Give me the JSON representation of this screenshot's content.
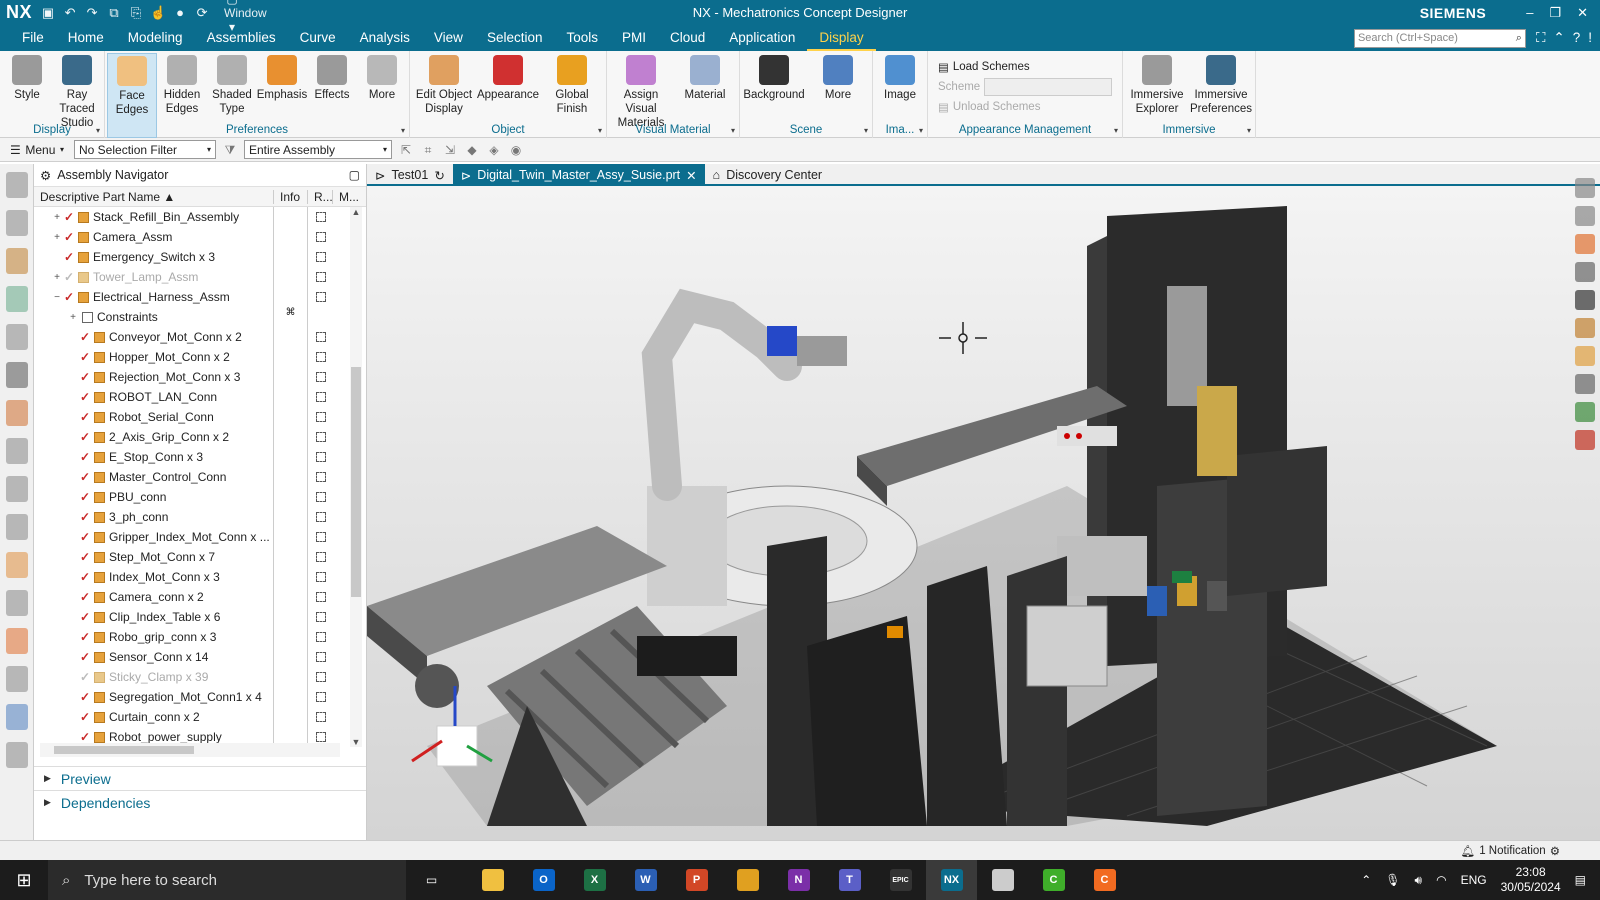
{
  "window": {
    "logo": "NX",
    "title": "NX - Mechatronics Concept Designer",
    "brand": "SIEMENS",
    "window_menu": "Window"
  },
  "menu": {
    "items": [
      "File",
      "Home",
      "Modeling",
      "Assemblies",
      "Curve",
      "Analysis",
      "View",
      "Selection",
      "Tools",
      "PMI",
      "Cloud",
      "Application",
      "Display"
    ],
    "active": "Display",
    "search_placeholder": "Search (Ctrl+Space)"
  },
  "ribbon": {
    "display_group": {
      "label": "Display",
      "buttons": [
        "Style",
        "Ray Traced Studio"
      ]
    },
    "preferences_group": {
      "label": "Preferences",
      "buttons": [
        "Face Edges",
        "Hidden Edges",
        "Shaded Type",
        "Emphasis",
        "Effects",
        "More"
      ]
    },
    "object_group": {
      "label": "Object",
      "buttons": [
        "Edit Object Display",
        "Appearance",
        "Global Finish"
      ]
    },
    "visual_material_group": {
      "label": "Visual Material",
      "buttons": [
        "Assign Visual Materials",
        "Material"
      ]
    },
    "scene_group": {
      "label": "Scene",
      "buttons": [
        "Background",
        "More"
      ]
    },
    "image_group": {
      "label": "Ima...",
      "buttons": [
        "Image"
      ]
    },
    "appearance_mgmt": {
      "label": "Appearance Management",
      "load": "Load Schemes",
      "scheme_label": "Scheme",
      "unload": "Unload Schemes"
    },
    "immersive_group": {
      "label": "Immersive",
      "buttons": [
        "Immersive Explorer",
        "Immersive Preferences"
      ]
    }
  },
  "toolbar2": {
    "menu": "Menu",
    "selection_filter": "No Selection Filter",
    "scope": "Entire Assembly"
  },
  "navigator": {
    "title": "Assembly Navigator",
    "columns": [
      "Descriptive Part Name",
      "Info",
      "R...",
      "M..."
    ],
    "rows": [
      {
        "label": "Stack_Refill_Bin_Assembly",
        "level": 1,
        "exp": "+",
        "dim": false
      },
      {
        "label": "Camera_Assm",
        "level": 1,
        "exp": "+",
        "dim": false
      },
      {
        "label": "Emergency_Switch x 3",
        "level": 1,
        "exp": "",
        "dim": false
      },
      {
        "label": "Tower_Lamp_Assm",
        "level": 1,
        "exp": "+",
        "dim": true
      },
      {
        "label": "Electrical_Harness_Assm",
        "level": 1,
        "exp": "−",
        "dim": false
      },
      {
        "label": "Constraints",
        "level": 2,
        "exp": "+",
        "dim": false,
        "type": "constraints"
      },
      {
        "label": "Conveyor_Mot_Conn x 2",
        "level": 2,
        "exp": "",
        "dim": false
      },
      {
        "label": "Hopper_Mot_Conn x 2",
        "level": 2,
        "exp": "",
        "dim": false
      },
      {
        "label": "Rejection_Mot_Conn x 3",
        "level": 2,
        "exp": "",
        "dim": false
      },
      {
        "label": "ROBOT_LAN_Conn",
        "level": 2,
        "exp": "",
        "dim": false
      },
      {
        "label": "Robot_Serial_Conn",
        "level": 2,
        "exp": "",
        "dim": false
      },
      {
        "label": "2_Axis_Grip_Conn x 2",
        "level": 2,
        "exp": "",
        "dim": false
      },
      {
        "label": "E_Stop_Conn x 3",
        "level": 2,
        "exp": "",
        "dim": false
      },
      {
        "label": "Master_Control_Conn",
        "level": 2,
        "exp": "",
        "dim": false
      },
      {
        "label": "PBU_conn",
        "level": 2,
        "exp": "",
        "dim": false
      },
      {
        "label": "3_ph_conn",
        "level": 2,
        "exp": "",
        "dim": false
      },
      {
        "label": "Gripper_Index_Mot_Conn x ...",
        "level": 2,
        "exp": "",
        "dim": false
      },
      {
        "label": "Step_Mot_Conn x 7",
        "level": 2,
        "exp": "",
        "dim": false
      },
      {
        "label": "Index_Mot_Conn x 3",
        "level": 2,
        "exp": "",
        "dim": false
      },
      {
        "label": "Camera_conn x 2",
        "level": 2,
        "exp": "",
        "dim": false
      },
      {
        "label": "Clip_Index_Table x 6",
        "level": 2,
        "exp": "",
        "dim": false
      },
      {
        "label": "Robo_grip_conn x 3",
        "level": 2,
        "exp": "",
        "dim": false
      },
      {
        "label": "Sensor_Conn x 14",
        "level": 2,
        "exp": "",
        "dim": false
      },
      {
        "label": "Sticky_Clamp x 39",
        "level": 2,
        "exp": "",
        "dim": true
      },
      {
        "label": "Segregation_Mot_Conn1 x 4",
        "level": 2,
        "exp": "",
        "dim": false
      },
      {
        "label": "Curtain_conn x 2",
        "level": 2,
        "exp": "",
        "dim": false
      },
      {
        "label": "Robot_power_supply",
        "level": 2,
        "exp": "",
        "dim": false
      }
    ],
    "sections": [
      "Preview",
      "Dependencies"
    ]
  },
  "tabs": [
    {
      "label": "Test01",
      "active": false
    },
    {
      "label": "Digital_Twin_Master_Assy_Susie.prt",
      "active": true
    },
    {
      "label": "Discovery Center",
      "active": false
    }
  ],
  "status": {
    "notification": "1 Notification"
  },
  "taskbar": {
    "search_placeholder": "Type here to search",
    "language": "ENG",
    "time": "23:08",
    "date": "30/05/2024",
    "apps": [
      {
        "name": "file-explorer",
        "color": "#f0c040",
        "glyph": ""
      },
      {
        "name": "outlook",
        "color": "#0a64c8",
        "glyph": "O"
      },
      {
        "name": "excel",
        "color": "#1d7044",
        "glyph": "X"
      },
      {
        "name": "word",
        "color": "#2b5fb4",
        "glyph": "W"
      },
      {
        "name": "powerpoint",
        "color": "#d24726",
        "glyph": "P"
      },
      {
        "name": "chrome",
        "color": "#e0a020",
        "glyph": ""
      },
      {
        "name": "onenote",
        "color": "#7b2fa8",
        "glyph": "N"
      },
      {
        "name": "teams",
        "color": "#5b5fc7",
        "glyph": "T"
      },
      {
        "name": "epic-games",
        "color": "#333333",
        "glyph": "EPIC"
      },
      {
        "name": "nx",
        "color": "#0b6d8e",
        "glyph": "NX"
      },
      {
        "name": "app-white",
        "color": "#cccccc",
        "glyph": ""
      },
      {
        "name": "camtasia-green",
        "color": "#3fae2a",
        "glyph": "C"
      },
      {
        "name": "camtasia-orange",
        "color": "#f26b21",
        "glyph": "C"
      }
    ]
  },
  "colors": {
    "accent": "#0b6d8e",
    "highlight": "#ffd24a"
  }
}
